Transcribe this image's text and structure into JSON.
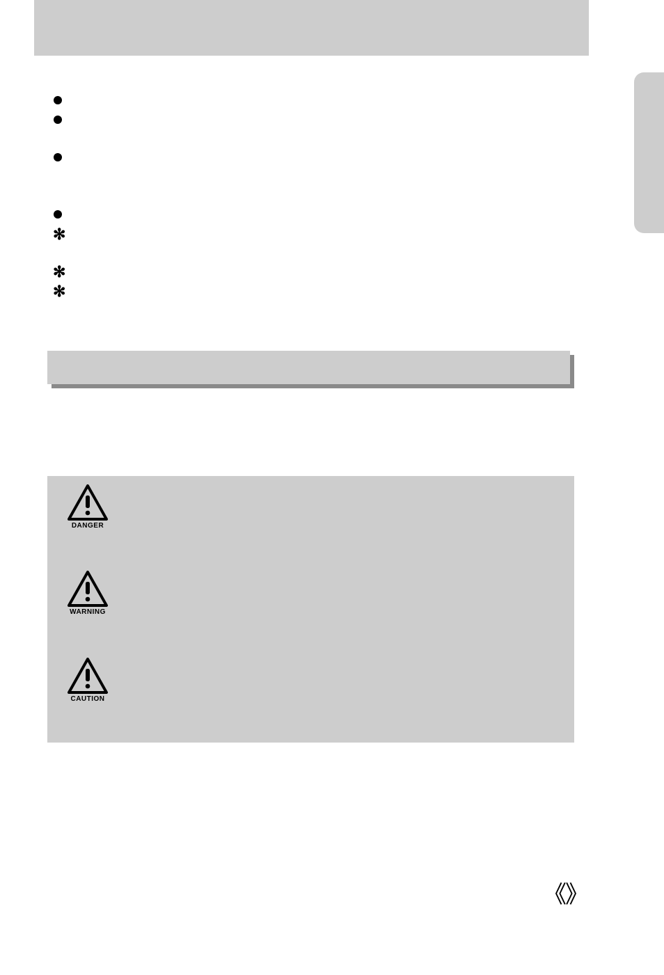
{
  "hazard_labels": {
    "danger": "DANGER",
    "warning": "WARNING",
    "caution": "CAUTION"
  },
  "footer": {
    "left_bracket": "《",
    "right_bracket": "》"
  }
}
